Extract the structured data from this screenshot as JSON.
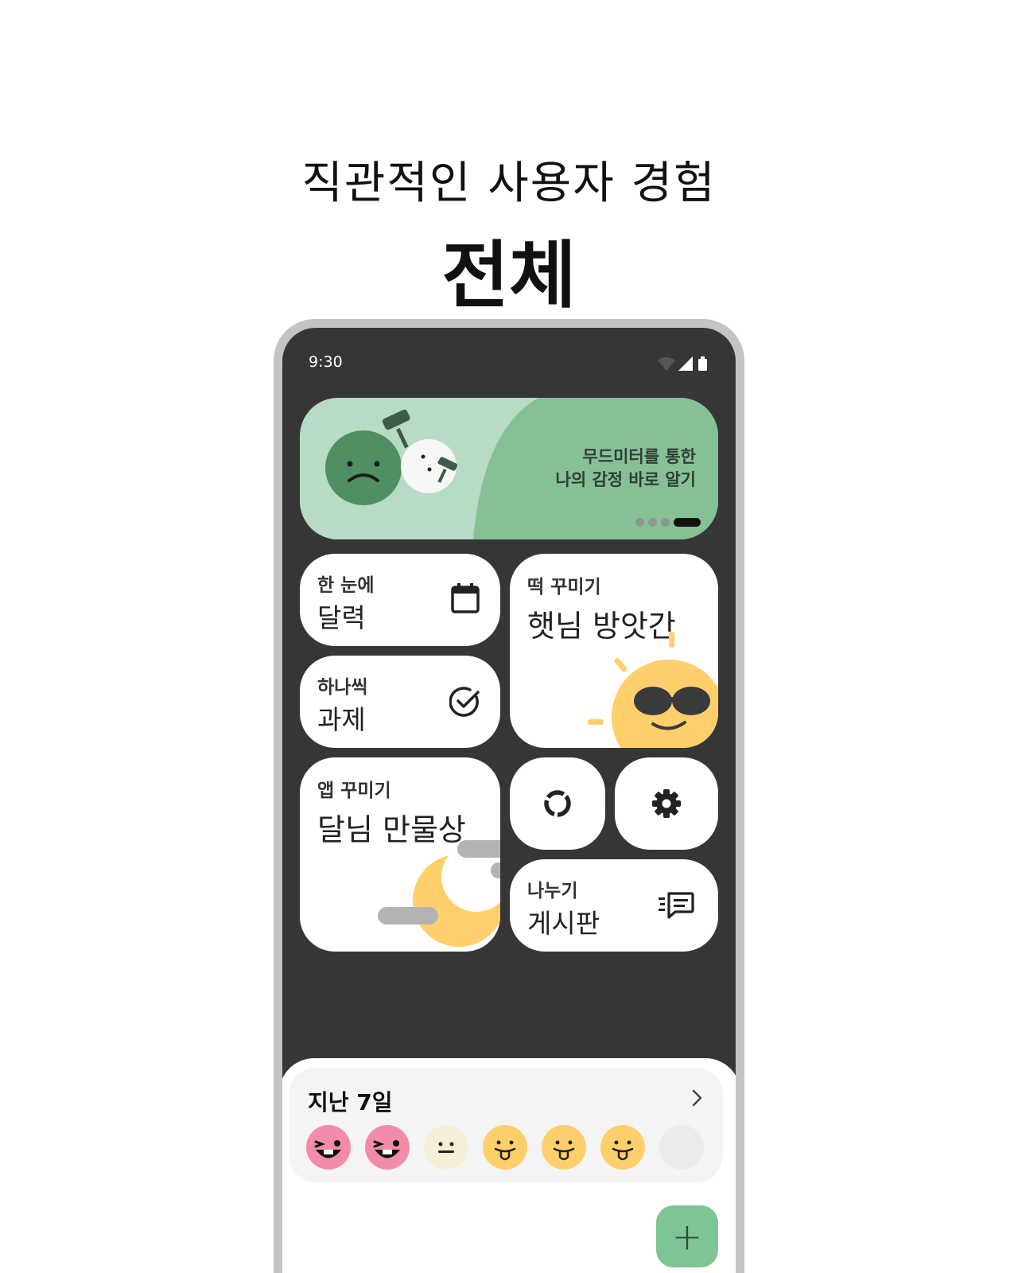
{
  "header": {
    "subtitle": "직관적인 사용자 경험",
    "title": "전체"
  },
  "status_bar": {
    "time": "9:30"
  },
  "banner": {
    "line1": "무드미터를 통한",
    "line2": "나의 감정 바로 알기",
    "pages": 4,
    "active_page": 4
  },
  "cards": {
    "calendar": {
      "small": "한 눈에",
      "big": "달력",
      "icon": "calendar-icon"
    },
    "tasks": {
      "small": "하나씩",
      "big": "과제",
      "icon": "check-circle-icon"
    },
    "rice_cake": {
      "small": "떡 꾸미기",
      "big": "햇님 방앗간"
    },
    "app_decor": {
      "small": "앱 꾸미기",
      "big": "달님 만물상"
    },
    "stats": {
      "icon": "donut-chart-icon"
    },
    "settings": {
      "icon": "gear-icon"
    },
    "board": {
      "small": "나누기",
      "big": "게시판",
      "icon": "chat-list-icon"
    }
  },
  "week": {
    "title": "지난 7일"
  },
  "fab": {
    "label": "+"
  },
  "colors": {
    "accent": "#7ec495",
    "banner_bg": "#b8dbc6",
    "banner_shape": "#86c196",
    "background": "#363636"
  }
}
